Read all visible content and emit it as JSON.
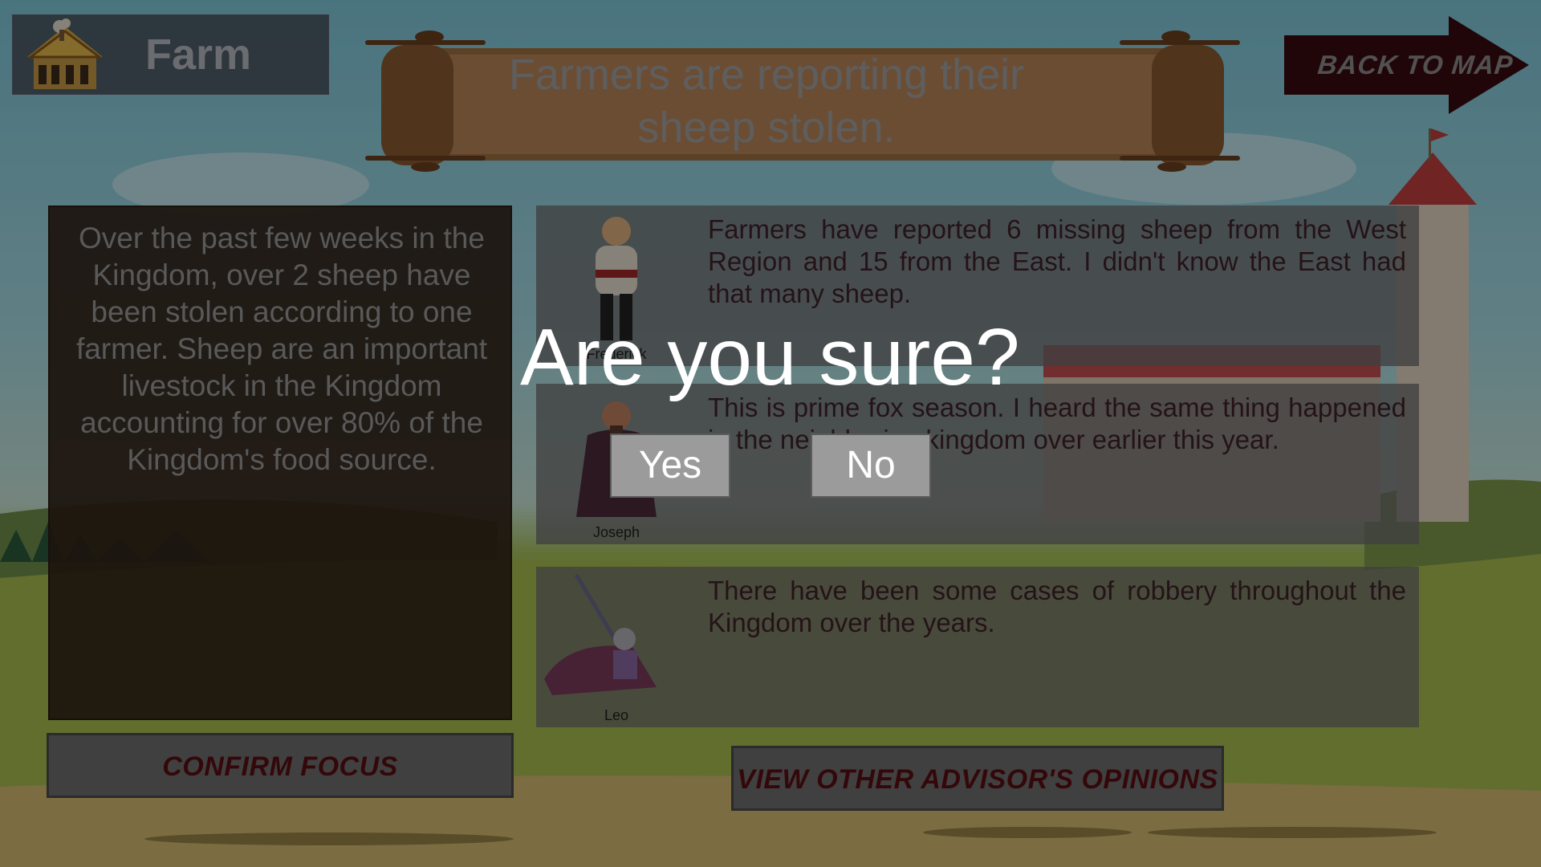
{
  "location": {
    "title": "Farm",
    "icon": "farm-barn-icon"
  },
  "headline": "Farmers are reporting their sheep stolen.",
  "back_button": {
    "label": "BACK TO MAP"
  },
  "summary": {
    "text": "Over the past few weeks in the Kingdom, over 2 sheep have been stolen according to one farmer. Sheep are an important livestock in the Kingdom accounting for over 80% of the Kingdom's food source."
  },
  "confirm_button": {
    "label": "CONFIRM FOCUS"
  },
  "advisors": [
    {
      "name": "Frederick",
      "opinion": "Farmers have reported 6 missing sheep from the West Region and 15 from the East. I didn't know the East had that many sheep."
    },
    {
      "name": "Joseph",
      "opinion": "This is prime fox season. I heard the same thing happened in the neighboring kingdom over earlier this year."
    },
    {
      "name": "Leo",
      "opinion": "There have been some cases of robbery throughout the Kingdom over the years."
    }
  ],
  "view_button": {
    "label": "VIEW OTHER ADVISOR'S OPINIONS"
  },
  "dialog": {
    "title": "Are you sure?",
    "yes": "Yes",
    "no": "No"
  }
}
